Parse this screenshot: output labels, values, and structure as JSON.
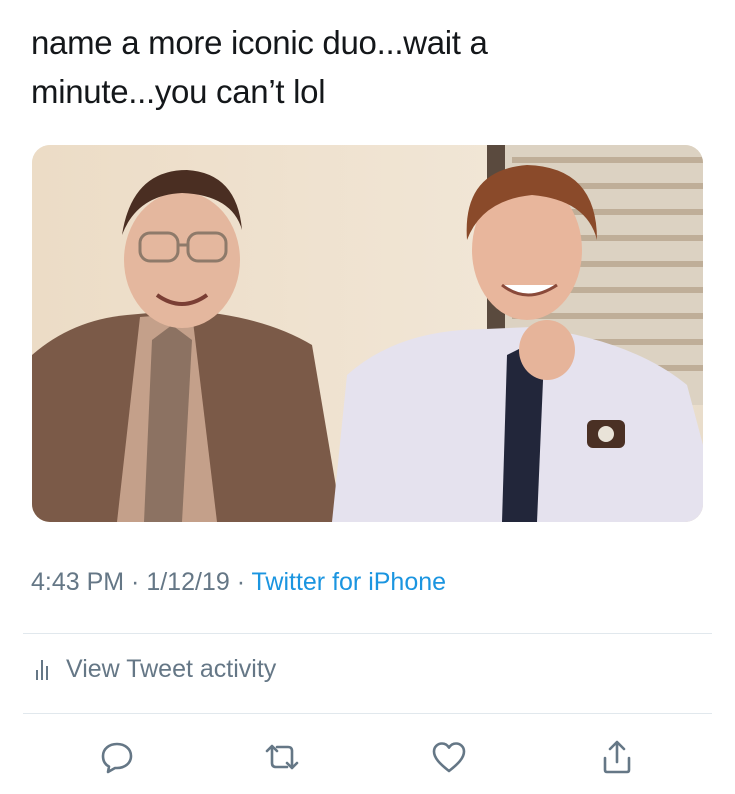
{
  "tweet": {
    "text_line1": "name a more iconic duo...wait a",
    "text_line2": "minute...you can’t lol",
    "media_alt": "Two men in office attire smiling on a couch"
  },
  "meta": {
    "time": "4:43 PM",
    "sep1": " · ",
    "date": "1/12/19",
    "sep2": " · ",
    "source": "Twitter for iPhone"
  },
  "activity": {
    "label": "View Tweet activity",
    "icon": "bar-chart-icon"
  },
  "actions": {
    "reply_icon": "reply-icon",
    "retweet_icon": "retweet-icon",
    "like_icon": "heart-icon",
    "share_icon": "share-icon",
    "icon_color": "#657786"
  },
  "colors": {
    "text": "#14171a",
    "secondary": "#657786",
    "link": "#1b95e0",
    "divider": "#e1e8ed"
  }
}
